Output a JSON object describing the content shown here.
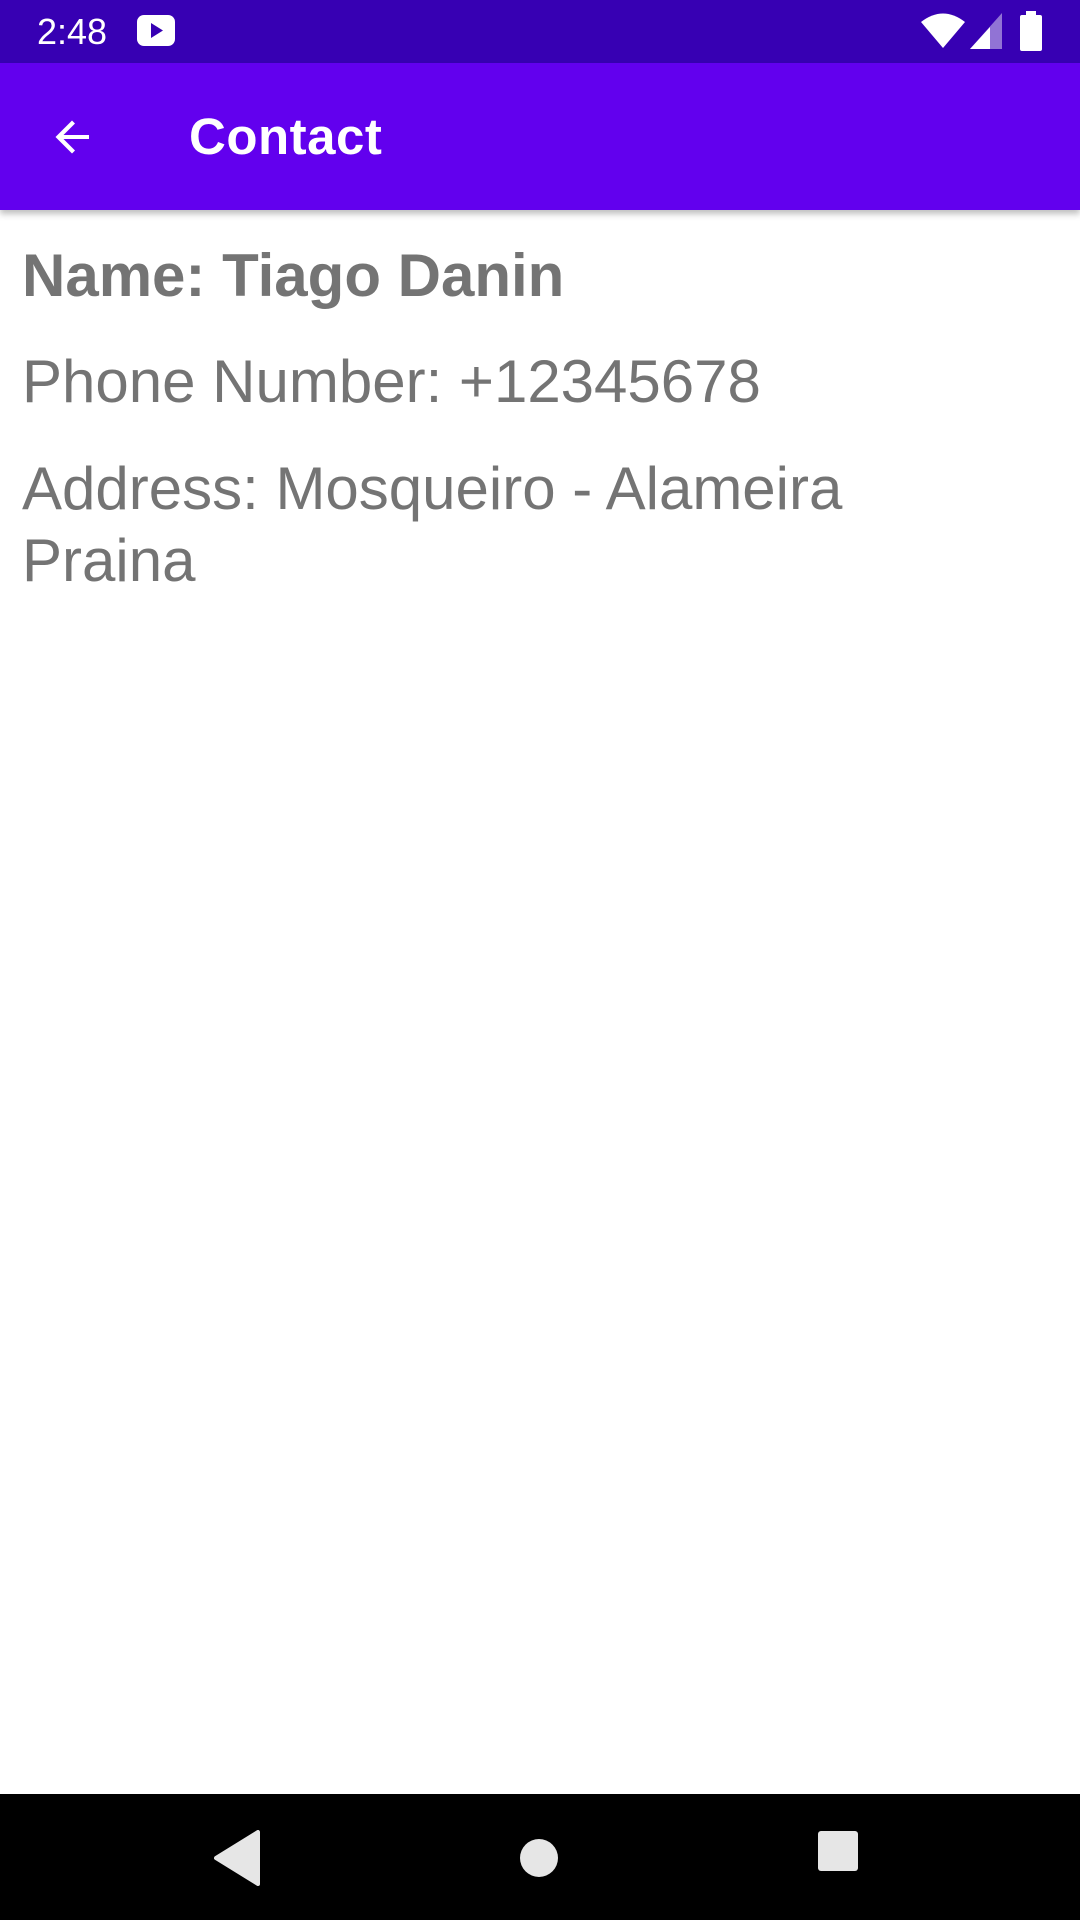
{
  "status_bar": {
    "time": "2:48",
    "icons": [
      "youtube-notification-icon",
      "wifi-icon",
      "cell-signal-icon",
      "battery-icon"
    ],
    "color": "#3700b3"
  },
  "app_bar": {
    "title": "Contact",
    "back_icon": "arrow-left-icon",
    "color": "#6200ee"
  },
  "contact": {
    "name": "Name: Tiago Danin",
    "phone": "Phone Number: +12345678",
    "address": "Address: Mosqueiro - Alameira Praina"
  },
  "nav_bar": {
    "icons": [
      "nav-back-icon",
      "nav-home-icon",
      "nav-recents-icon"
    ]
  },
  "colors": {
    "text": "#747474",
    "background": "#ffffff",
    "nav_bar": "#000000"
  }
}
